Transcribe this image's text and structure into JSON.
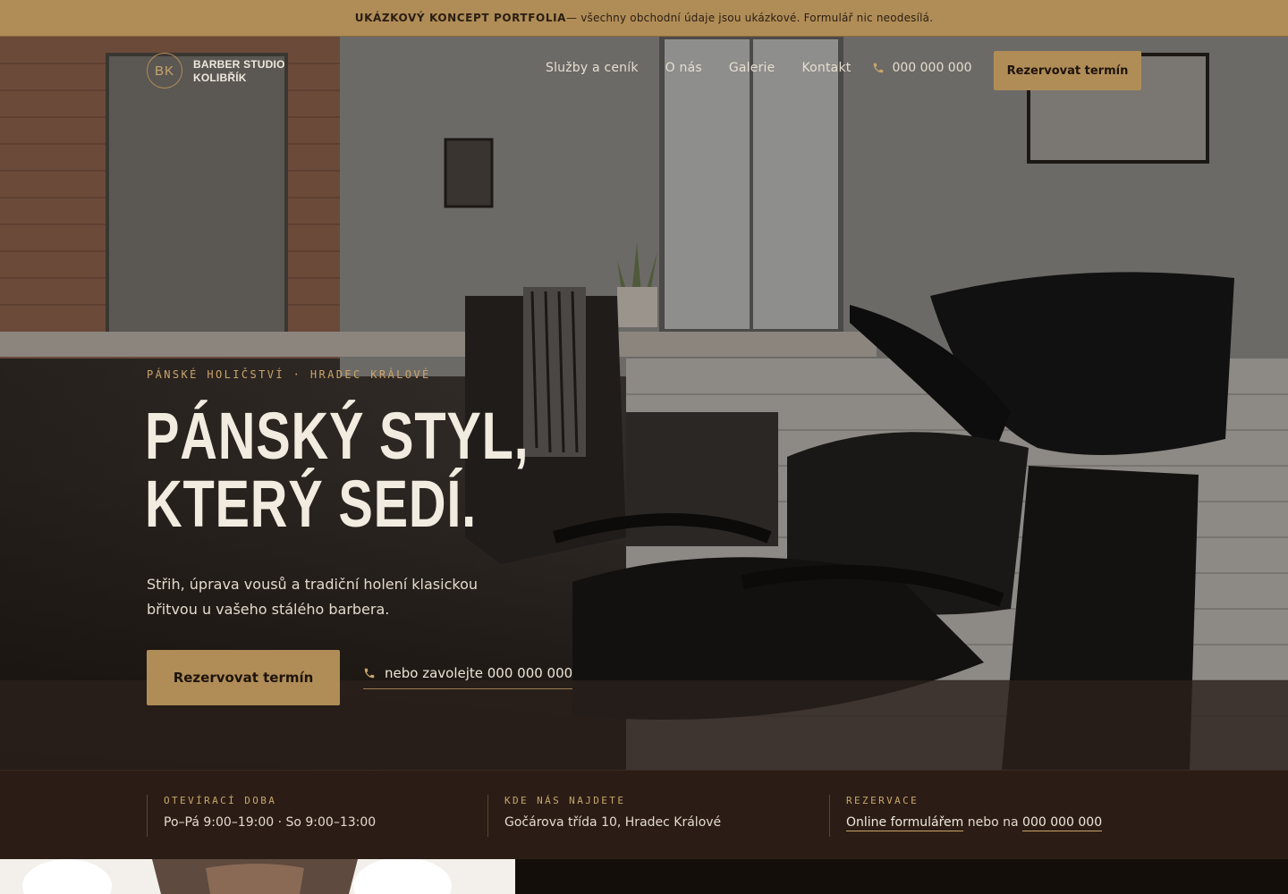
{
  "notice": {
    "bold": "UKÁZKOVÝ KONCEPT PORTFOLIA",
    "text": "— všechny obchodní údaje jsou ukázkové. Formulář nic neodesílá."
  },
  "brand": {
    "initials": "BK",
    "name": "BARBER STUDIO KOLIBŘÍK"
  },
  "nav": {
    "items": [
      "Služby a ceník",
      "O nás",
      "Galerie",
      "Kontakt"
    ],
    "phone": "000 000 000",
    "icon": "phone-icon",
    "cta": "Rezervovat termín"
  },
  "hero": {
    "eyebrow": "PÁNSKÉ HOLIČSTVÍ · HRADEC KRÁLOVÉ",
    "title_line1": "PÁNSKÝ STYL,",
    "title_line2": "KTERÝ SEDÍ.",
    "lead": "Střih, úprava vousů a tradiční holení klasickou břitvou u vašeho stálého barbera.",
    "cta": "Rezervovat termín",
    "call": "nebo zavolejte 000 000 000"
  },
  "info": {
    "hours": {
      "label": "OTEVÍRACÍ DOBA",
      "value": "Po–Pá 9:00–19:00 · So 9:00–13:00"
    },
    "location": {
      "label": "KDE NÁS NAJDETE",
      "value": "Gočárova třída 10, Hradec Králové"
    },
    "booking": {
      "label": "REZERVACE",
      "link": "Online formulářem",
      "middle": " nebo na ",
      "phone": "000 000 000"
    }
  },
  "colors": {
    "accent": "#b08d57",
    "accent_text": "#c9a56b",
    "dark": "#2b1d15",
    "text": "#efe8dd"
  }
}
